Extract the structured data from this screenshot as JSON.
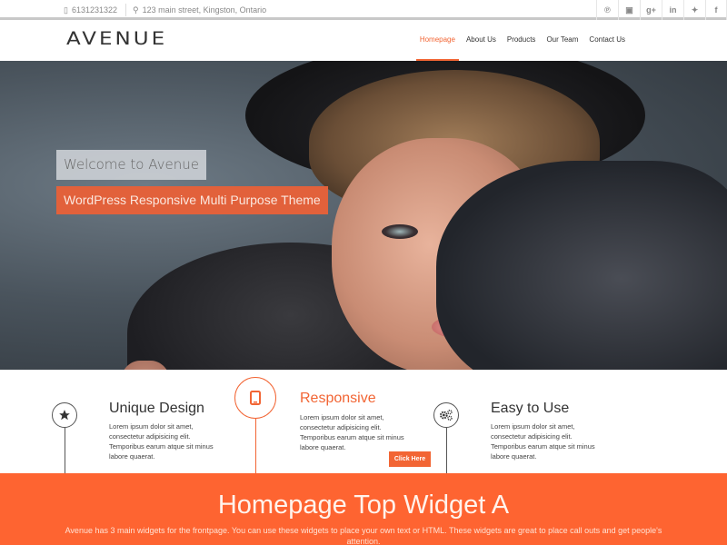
{
  "topbar": {
    "phone_icon": "mobile-phone-icon",
    "phone": "6131231322",
    "address_icon": "map-marker-icon",
    "address": "123 main street, Kingston, Ontario",
    "social": [
      {
        "name": "pinterest",
        "glyph": "℗"
      },
      {
        "name": "youtube",
        "glyph": "▣"
      },
      {
        "name": "google-plus",
        "glyph": "g+"
      },
      {
        "name": "linkedin",
        "glyph": "in"
      },
      {
        "name": "twitter",
        "glyph": "✦"
      },
      {
        "name": "facebook",
        "glyph": "f"
      }
    ]
  },
  "header": {
    "logo": "AVENUE",
    "nav": [
      {
        "label": "Homepage",
        "active": true
      },
      {
        "label": "About Us",
        "active": false
      },
      {
        "label": "Products",
        "active": false
      },
      {
        "label": "Our Team",
        "active": false
      },
      {
        "label": "Contact Us",
        "active": false
      }
    ]
  },
  "hero": {
    "welcome": "Welcome to Avenue",
    "tagline": "WordPress Responsive Multi Purpose Theme"
  },
  "features": [
    {
      "icon": "star-icon",
      "title": "Unique Design",
      "text": "Lorem ipsum dolor sit amet, consectetur adipisicing elit. Temporibus earum atque sit minus labore quaerat."
    },
    {
      "icon": "mobile-icon",
      "title": "Responsive",
      "text": "Lorem ipsum dolor sit amet, consectetur adipisicing elit. Temporibus earum atque sit minus labore quaerat.",
      "button": "Click Here"
    },
    {
      "icon": "cogs-icon",
      "title": "Easy to Use",
      "text": "Lorem ipsum dolor sit amet, consectetur adipisicing elit. Temporibus earum atque sit minus labore quaerat."
    }
  ],
  "widget": {
    "title": "Homepage Top Widget A",
    "text": "Avenue has 3 main widgets for the frontpage. You can use these widgets to place your own text or HTML. These widgets are great to place call outs and get people's attention."
  },
  "colors": {
    "accent": "#f26534",
    "widget_bg": "#fe6431",
    "tagline_bg": "#e2613b"
  }
}
